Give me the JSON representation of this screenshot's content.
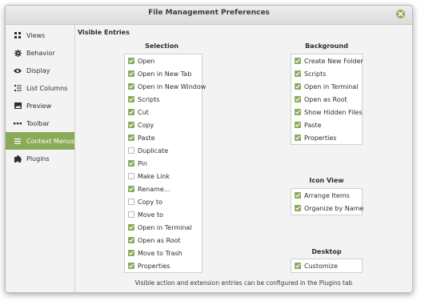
{
  "window": {
    "title": "File Management Preferences"
  },
  "sidebar": {
    "items": [
      {
        "label": "Views",
        "icon": "grid-icon",
        "active": false
      },
      {
        "label": "Behavior",
        "icon": "gear-icon",
        "active": false
      },
      {
        "label": "Display",
        "icon": "eye-icon",
        "active": false
      },
      {
        "label": "List Columns",
        "icon": "list-icon",
        "active": false
      },
      {
        "label": "Preview",
        "icon": "image-icon",
        "active": false
      },
      {
        "label": "Toolbar",
        "icon": "dots-icon",
        "active": false
      },
      {
        "label": "Context Menus",
        "icon": "menu-icon",
        "active": true
      },
      {
        "label": "Plugins",
        "icon": "puzzle-icon",
        "active": false
      }
    ]
  },
  "main": {
    "heading": "Visible Entries",
    "selection": {
      "title": "Selection",
      "items": [
        {
          "label": "Open",
          "checked": true
        },
        {
          "label": "Open in New Tab",
          "checked": true
        },
        {
          "label": "Open in New Window",
          "checked": true
        },
        {
          "label": "Scripts",
          "checked": true
        },
        {
          "label": "Cut",
          "checked": true
        },
        {
          "label": "Copy",
          "checked": true
        },
        {
          "label": "Paste",
          "checked": true
        },
        {
          "label": "Duplicate",
          "checked": false
        },
        {
          "label": "Pin",
          "checked": true
        },
        {
          "label": "Make Link",
          "checked": false
        },
        {
          "label": "Rename...",
          "checked": true
        },
        {
          "label": "Copy to",
          "checked": false
        },
        {
          "label": "Move to",
          "checked": false
        },
        {
          "label": "Open in Terminal",
          "checked": true
        },
        {
          "label": "Open as Root",
          "checked": true
        },
        {
          "label": "Move to Trash",
          "checked": true
        },
        {
          "label": "Properties",
          "checked": true
        }
      ]
    },
    "background": {
      "title": "Background",
      "items": [
        {
          "label": "Create New Folder",
          "checked": true
        },
        {
          "label": "Scripts",
          "checked": true
        },
        {
          "label": "Open in Terminal",
          "checked": true
        },
        {
          "label": "Open as Root",
          "checked": true
        },
        {
          "label": "Show Hidden Files",
          "checked": true
        },
        {
          "label": "Paste",
          "checked": true
        },
        {
          "label": "Properties",
          "checked": true
        }
      ]
    },
    "icon_view": {
      "title": "Icon View",
      "items": [
        {
          "label": "Arrange Items",
          "checked": true
        },
        {
          "label": "Organize by Name",
          "checked": true
        }
      ]
    },
    "desktop": {
      "title": "Desktop",
      "items": [
        {
          "label": "Customize",
          "checked": true
        }
      ]
    },
    "footer": "Visible action and extension entries can be configured in the Plugins tab"
  },
  "colors": {
    "accent": "#8aaa58",
    "window_bg": "#f3f3f3",
    "list_bg": "#ffffff",
    "text": "#2e2e2e"
  }
}
